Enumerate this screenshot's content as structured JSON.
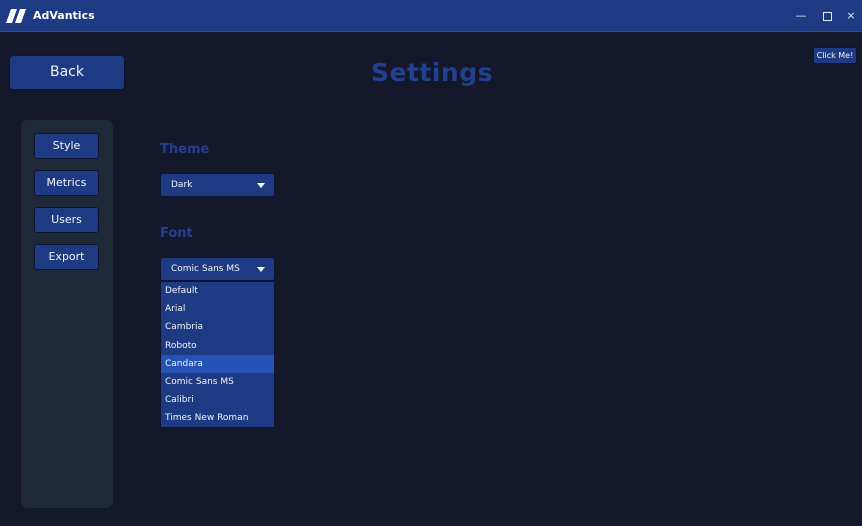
{
  "window": {
    "title": "AdVantics",
    "controls": {
      "minimize": "—",
      "close": "×"
    }
  },
  "header": {
    "back_label": "Back",
    "page_title": "Settings",
    "click_me_label": "Click Me!"
  },
  "sidebar": {
    "items": [
      {
        "label": "Style"
      },
      {
        "label": "Metrics"
      },
      {
        "label": "Users"
      },
      {
        "label": "Export"
      }
    ]
  },
  "settings": {
    "theme": {
      "label": "Theme",
      "value": "Dark"
    },
    "font": {
      "label": "Font",
      "value": "Comic Sans MS",
      "options": [
        "Default",
        "Arial",
        "Cambria",
        "Roboto",
        "Candara",
        "Comic Sans MS",
        "Calibri",
        "Times New Roman"
      ],
      "hovered_option": "Candara"
    }
  },
  "colors": {
    "titlebar": "#1e3a82",
    "background": "#14182a",
    "sidebar": "#1f2837",
    "accent": "#22408f",
    "hover": "#2552b5"
  },
  "icons": {
    "logo": "advantics-logo-icon",
    "maximize": "maximize-icon",
    "dropdown": "chevron-down-icon"
  }
}
